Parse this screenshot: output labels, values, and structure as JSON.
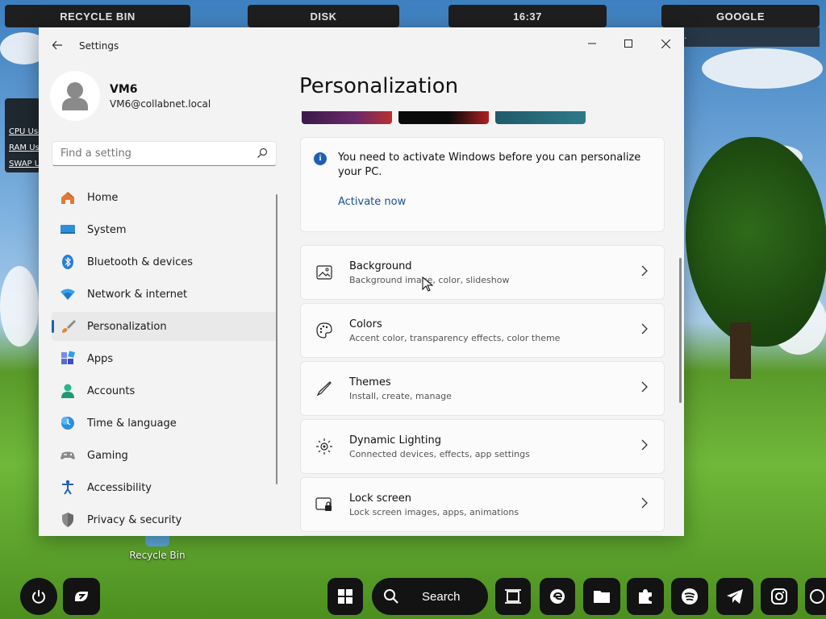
{
  "desktop": {
    "top_bar": {
      "recycle": "RECYCLE BIN",
      "disk": "DISK",
      "clock": "16:37",
      "google": "GOOGLE",
      "google_search": "ch..."
    },
    "sys_widget": {
      "cpu": "CPU Usage",
      "ram": "RAM Usage",
      "swap": "SWAP Usage"
    },
    "recycle_bin_label": "Recycle Bin"
  },
  "window": {
    "title": "Settings",
    "profile": {
      "name": "VM6",
      "email": "VM6@collabnet.local"
    },
    "search": {
      "placeholder": "Find a setting"
    },
    "nav": {
      "items": [
        {
          "label": "Home",
          "icon": "home-icon"
        },
        {
          "label": "System",
          "icon": "system-icon"
        },
        {
          "label": "Bluetooth & devices",
          "icon": "bluetooth-icon"
        },
        {
          "label": "Network & internet",
          "icon": "network-icon"
        },
        {
          "label": "Personalization",
          "icon": "brush-icon",
          "active": true
        },
        {
          "label": "Apps",
          "icon": "apps-icon"
        },
        {
          "label": "Accounts",
          "icon": "accounts-icon"
        },
        {
          "label": "Time & language",
          "icon": "globe-icon"
        },
        {
          "label": "Gaming",
          "icon": "gaming-icon"
        },
        {
          "label": "Accessibility",
          "icon": "accessibility-icon"
        },
        {
          "label": "Privacy & security",
          "icon": "shield-icon"
        }
      ]
    },
    "page_title": "Personalization",
    "activation": {
      "message": "You need to activate Windows before you can personalize your PC.",
      "link": "Activate now"
    },
    "cards": [
      {
        "title": "Background",
        "subtitle": "Background image, color, slideshow",
        "icon": "image-icon"
      },
      {
        "title": "Colors",
        "subtitle": "Accent color, transparency effects, color theme",
        "icon": "palette-icon"
      },
      {
        "title": "Themes",
        "subtitle": "Install, create, manage",
        "icon": "pen-icon"
      },
      {
        "title": "Dynamic Lighting",
        "subtitle": "Connected devices, effects, app settings",
        "icon": "sun-icon"
      },
      {
        "title": "Lock screen",
        "subtitle": "Lock screen images, apps, animations",
        "icon": "lock-screen-icon"
      }
    ]
  },
  "taskbar": {
    "search_label": "Search"
  }
}
